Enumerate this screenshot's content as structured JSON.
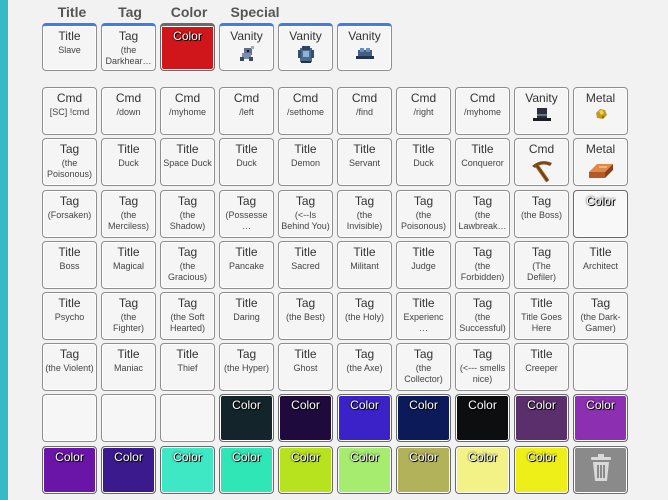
{
  "headers": [
    "Title",
    "Tag",
    "Color",
    "Special"
  ],
  "equipped": [
    {
      "title": "Title",
      "sub": "Slave",
      "kind": "text"
    },
    {
      "title": "Tag",
      "sub": "(the Darkhear…",
      "kind": "text"
    },
    {
      "title": "Color",
      "sub": "",
      "kind": "color",
      "color": "#d0161a"
    },
    {
      "title": "Vanity",
      "sub": "",
      "kind": "icon",
      "icon": "vanity-creature-icon"
    },
    {
      "title": "Vanity",
      "sub": "",
      "kind": "icon",
      "icon": "vanity-armor-icon"
    },
    {
      "title": "Vanity",
      "sub": "",
      "kind": "icon",
      "icon": "vanity-hat-icon"
    }
  ],
  "inventory": [
    [
      {
        "title": "Cmd",
        "sub": "[SC] !cmd"
      },
      {
        "title": "Cmd",
        "sub": "/down"
      },
      {
        "title": "Cmd",
        "sub": "/myhome"
      },
      {
        "title": "Cmd",
        "sub": "/left"
      },
      {
        "title": "Cmd",
        "sub": "/sethome"
      },
      {
        "title": "Cmd",
        "sub": "/find"
      },
      {
        "title": "Cmd",
        "sub": "/right"
      },
      {
        "title": "Cmd",
        "sub": "/myhome"
      },
      {
        "title": "Vanity",
        "sub": "",
        "icon": "top-hat-icon"
      },
      {
        "title": "Metal",
        "sub": "",
        "icon": "gold-nugget-icon"
      }
    ],
    [
      {
        "title": "Tag",
        "sub": "(the Poisonous)"
      },
      {
        "title": "Title",
        "sub": "Duck"
      },
      {
        "title": "Title",
        "sub": "Space Duck"
      },
      {
        "title": "Title",
        "sub": "Duck"
      },
      {
        "title": "Title",
        "sub": "Demon"
      },
      {
        "title": "Title",
        "sub": "Servant"
      },
      {
        "title": "Title",
        "sub": "Duck"
      },
      {
        "title": "Title",
        "sub": "Conqueror"
      },
      {
        "title": "Cmd",
        "sub": "",
        "icon": "pickaxe-icon"
      },
      {
        "title": "Metal",
        "sub": "",
        "icon": "copper-ingot-icon"
      }
    ],
    [
      {
        "title": "Tag",
        "sub": "(Forsaken)"
      },
      {
        "title": "Tag",
        "sub": "(the Merciless)"
      },
      {
        "title": "Tag",
        "sub": "(the Shadow)"
      },
      {
        "title": "Tag",
        "sub": "(Possesse…"
      },
      {
        "title": "Tag",
        "sub": "(<--Is Behind You)"
      },
      {
        "title": "Tag",
        "sub": "(the Invisible)"
      },
      {
        "title": "Tag",
        "sub": "(the Poisonous)"
      },
      {
        "title": "Tag",
        "sub": "(the Lawbreak…"
      },
      {
        "title": "Tag",
        "sub": "(the Boss)"
      },
      {
        "title": "Color",
        "sub": "",
        "color": "#f8f8f8"
      }
    ],
    [
      {
        "title": "Title",
        "sub": "Boss"
      },
      {
        "title": "Title",
        "sub": "Magical"
      },
      {
        "title": "Tag",
        "sub": "(the Gracious)"
      },
      {
        "title": "Title",
        "sub": "Pancake"
      },
      {
        "title": "Title",
        "sub": "Sacred"
      },
      {
        "title": "Title",
        "sub": "Militant"
      },
      {
        "title": "Title",
        "sub": "Judge"
      },
      {
        "title": "Tag",
        "sub": "(the Forbidden)"
      },
      {
        "title": "Tag",
        "sub": "(The Defiler)"
      },
      {
        "title": "Title",
        "sub": "Architect"
      }
    ],
    [
      {
        "title": "Title",
        "sub": "Psycho"
      },
      {
        "title": "Tag",
        "sub": "(the Fighter)"
      },
      {
        "title": "Tag",
        "sub": "(the Soft Hearted)"
      },
      {
        "title": "Title",
        "sub": "Daring"
      },
      {
        "title": "Tag",
        "sub": "(the Best)"
      },
      {
        "title": "Tag",
        "sub": "(the Holy)"
      },
      {
        "title": "Title",
        "sub": "Experienc…"
      },
      {
        "title": "Tag",
        "sub": "(the Successful)"
      },
      {
        "title": "Title",
        "sub": "Title Goes Here"
      },
      {
        "title": "Tag",
        "sub": "(the Dark-Gamer)"
      }
    ],
    [
      {
        "title": "Tag",
        "sub": "(the Violent)"
      },
      {
        "title": "Title",
        "sub": "Maniac"
      },
      {
        "title": "Title",
        "sub": "Thief"
      },
      {
        "title": "Tag",
        "sub": "(the Hyper)"
      },
      {
        "title": "Title",
        "sub": "Ghost"
      },
      {
        "title": "Tag",
        "sub": "(the Axe)"
      },
      {
        "title": "Tag",
        "sub": "(the Collector)"
      },
      {
        "title": "Tag",
        "sub": "(<--- smells nice)"
      },
      {
        "title": "Title",
        "sub": "Creeper"
      },
      {
        "empty": true
      }
    ],
    [
      {
        "empty": true
      },
      {
        "empty": true
      },
      {
        "empty": true
      },
      {
        "title": "Color",
        "sub": "",
        "color": "#13252a"
      },
      {
        "title": "Color",
        "sub": "",
        "color": "#1f0a3e"
      },
      {
        "title": "Color",
        "sub": "",
        "color": "#3a22c8"
      },
      {
        "title": "Color",
        "sub": "",
        "color": "#0d1a5a"
      },
      {
        "title": "Color",
        "sub": "",
        "color": "#0c0e10"
      },
      {
        "title": "Color",
        "sub": "",
        "color": "#5b2f6b"
      },
      {
        "title": "Color",
        "sub": "",
        "color": "#8c2fb0"
      }
    ],
    [
      {
        "title": "Color",
        "sub": "",
        "color": "#6a14a8"
      },
      {
        "title": "Color",
        "sub": "",
        "color": "#3a1a8c"
      },
      {
        "title": "Color",
        "sub": "",
        "color": "#3ee8c4"
      },
      {
        "title": "Color",
        "sub": "",
        "color": "#2fe6b6"
      },
      {
        "title": "Color",
        "sub": "",
        "color": "#b6e21e"
      },
      {
        "title": "Color",
        "sub": "",
        "color": "#a6ec6e"
      },
      {
        "title": "Color",
        "sub": "",
        "color": "#b2b25a"
      },
      {
        "title": "Color",
        "sub": "",
        "color": "#f2f286"
      },
      {
        "title": "Color",
        "sub": "",
        "color": "#eeee18"
      },
      {
        "trash": true,
        "icon": "trash-icon"
      }
    ]
  ]
}
